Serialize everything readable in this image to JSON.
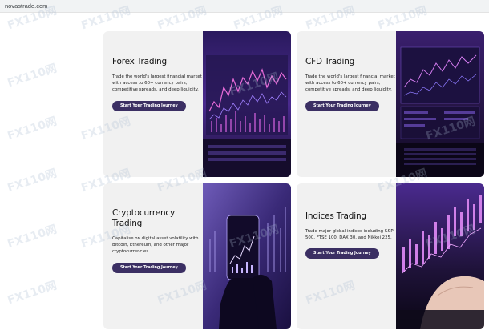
{
  "browser": {
    "url": "novastrade.com"
  },
  "cards": [
    {
      "title": "Forex Trading",
      "description": "Trade the world's largest financial market with access to 60+ currency pairs, competitive spreads, and deep liquidity.",
      "button": "Start Your Trading Journey"
    },
    {
      "title": "CFD Trading",
      "description": "Trade the world's largest financial market with access to 60+ currency pairs, competitive spreads, and deep liquidity.",
      "button": "Start Your Trading Journey"
    },
    {
      "title": "Cryptocurrency Trading",
      "description": "Capitalise on digital asset volatility with Bitcoin, Ethereum, and other major cryptocurrencies.",
      "button": "Start Your Trading Journey"
    },
    {
      "title": "Indices Trading",
      "description": "Trade major global indices including S&P 500, FTSE 100, DAX 30, and Nikkei 225.",
      "button": "Start Your Trading Journey"
    }
  ],
  "watermark": "FX110网"
}
